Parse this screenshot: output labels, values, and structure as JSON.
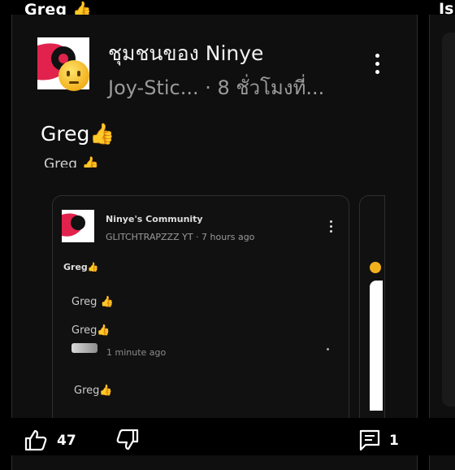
{
  "header": {
    "author_display": "Greg 👍",
    "next_post_prefix": "Is"
  },
  "post": {
    "community": "ชุมชนของ Ninye",
    "meta": "Joy-Stic...  · 8 ชั่วโมงที่...",
    "text": "Greg👍",
    "cut_text": "Greg 👍"
  },
  "inner": {
    "community": "Ninye's Community",
    "meta": "GLITCHTRAPZZZ YT · 7 hours ago",
    "greg1": "Greg👍",
    "greg2": "Greg 👍",
    "greg3": "Greg👍",
    "minute_ago": "1 minute ago",
    "greg4": "Greg👍"
  },
  "actions": {
    "likes": "47",
    "comments": "1"
  }
}
